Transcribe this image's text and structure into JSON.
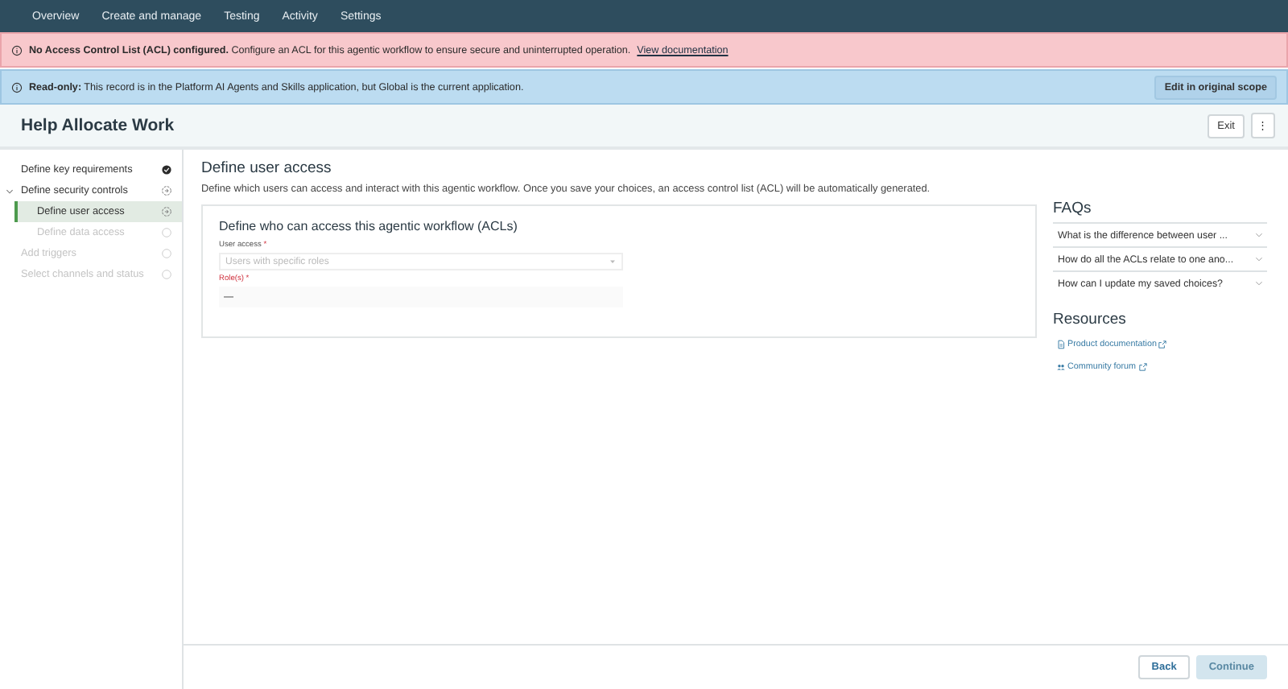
{
  "nav": {
    "items": [
      {
        "label": "Overview"
      },
      {
        "label": "Create and manage"
      },
      {
        "label": "Testing"
      },
      {
        "label": "Activity"
      },
      {
        "label": "Settings"
      }
    ]
  },
  "banners": [
    {
      "kind": "error",
      "title": "No Access Control List (ACL) configured.",
      "text": "Configure an ACL for this agentic workflow to ensure secure and uninterrupted operation.",
      "link": "View documentation"
    },
    {
      "kind": "info",
      "title": "Read-only:",
      "text": "This record is in the Platform AI Agents and Skills application, but Global is the current application.",
      "action": "Edit in original scope"
    }
  ],
  "header": {
    "title": "Help Allocate Work",
    "exit": "Exit",
    "more": "⋮"
  },
  "steps": [
    {
      "label": "Define key requirements",
      "kind": "done",
      "selected": false
    },
    {
      "label": "Define security controls",
      "kind": "current",
      "selected": false,
      "expanded": true,
      "children": [
        {
          "label": "Define user access",
          "kind": "current",
          "selected": true
        },
        {
          "label": "Define data access",
          "kind": "todo",
          "selected": false
        }
      ]
    },
    {
      "label": "Add triggers",
      "kind": "todo",
      "selected": false
    },
    {
      "label": "Select channels and status",
      "kind": "todo",
      "selected": false
    }
  ],
  "main": {
    "title": "Define user access",
    "description": "Define which users can access and interact with this agentic workflow. Once you save your choices, an access control list (ACL) will be automatically generated.",
    "card": {
      "title": "Define who can access this agentic workflow (ACLs)",
      "fields": [
        {
          "kind": "select",
          "label": "User access",
          "required": "*",
          "placeholder": "Users with specific roles",
          "error": false
        },
        {
          "kind": "text",
          "label": "Role(s)",
          "required": "*",
          "value": "—",
          "error": true
        }
      ]
    }
  },
  "faqs": {
    "title": "FAQs",
    "items": [
      {
        "question": "What is the difference between user ...",
        "expanded": false
      },
      {
        "question": "How do all the ACLs relate to one ano...",
        "expanded": false
      },
      {
        "question": "How can I update my saved choices?",
        "expanded": false
      }
    ]
  },
  "resources": {
    "title": "Resources",
    "links": [
      {
        "kind": "doc",
        "label": "Product documentation"
      },
      {
        "kind": "community",
        "label": "Community forum"
      }
    ]
  },
  "footer": {
    "buttons": [
      {
        "label": "Back",
        "disabled": false
      },
      {
        "label": "Continue",
        "disabled": true
      }
    ]
  }
}
